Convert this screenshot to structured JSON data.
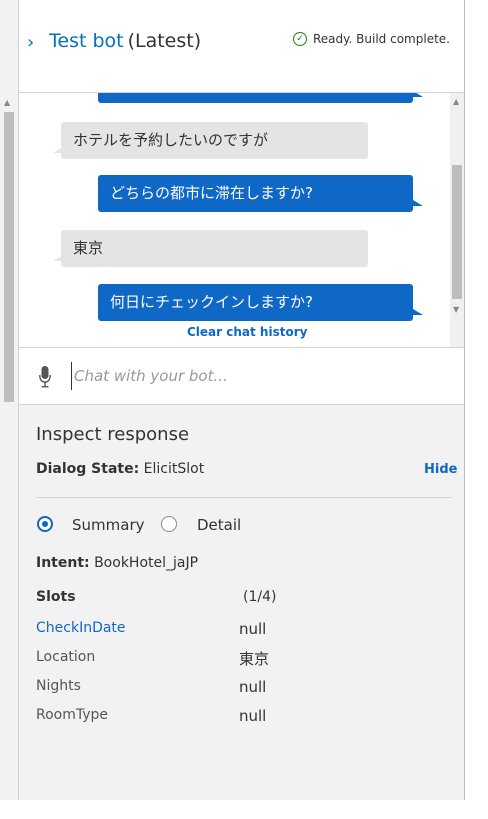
{
  "header": {
    "title": "Test bot",
    "version": "(Latest)",
    "status": "Ready. Build complete."
  },
  "chat": {
    "messages": [
      {
        "from": "user",
        "text": "ホテルを予約したいのですが"
      },
      {
        "from": "bot",
        "text": "どちらの都市に滞在しますか?"
      },
      {
        "from": "user",
        "text": "東京"
      },
      {
        "from": "bot",
        "text": "何日にチェックインしますか?"
      }
    ],
    "clear_label": "Clear chat history",
    "input_placeholder": "Chat with your bot..."
  },
  "inspect": {
    "title": "Inspect response",
    "dialog_state_label": "Dialog State:",
    "dialog_state_value": "ElicitSlot",
    "hide_label": "Hide",
    "view_options": [
      "Summary",
      "Detail"
    ],
    "selected_view": "Summary",
    "intent_label": "Intent:",
    "intent_value": "BookHotel_jaJP",
    "slots_label": "Slots",
    "slots_count": "(1/4)",
    "slots": [
      {
        "name": "CheckInDate",
        "value": "null"
      },
      {
        "name": "Location",
        "value": "東京"
      },
      {
        "name": "Nights",
        "value": "null"
      },
      {
        "name": "RoomType",
        "value": "null"
      }
    ]
  },
  "colors": {
    "accent": "#0f67c6",
    "success": "#1d8102",
    "panel_bg": "#f2f2f2"
  },
  "icons": [
    "chevron-right-icon",
    "check-circle-icon",
    "microphone-icon"
  ]
}
